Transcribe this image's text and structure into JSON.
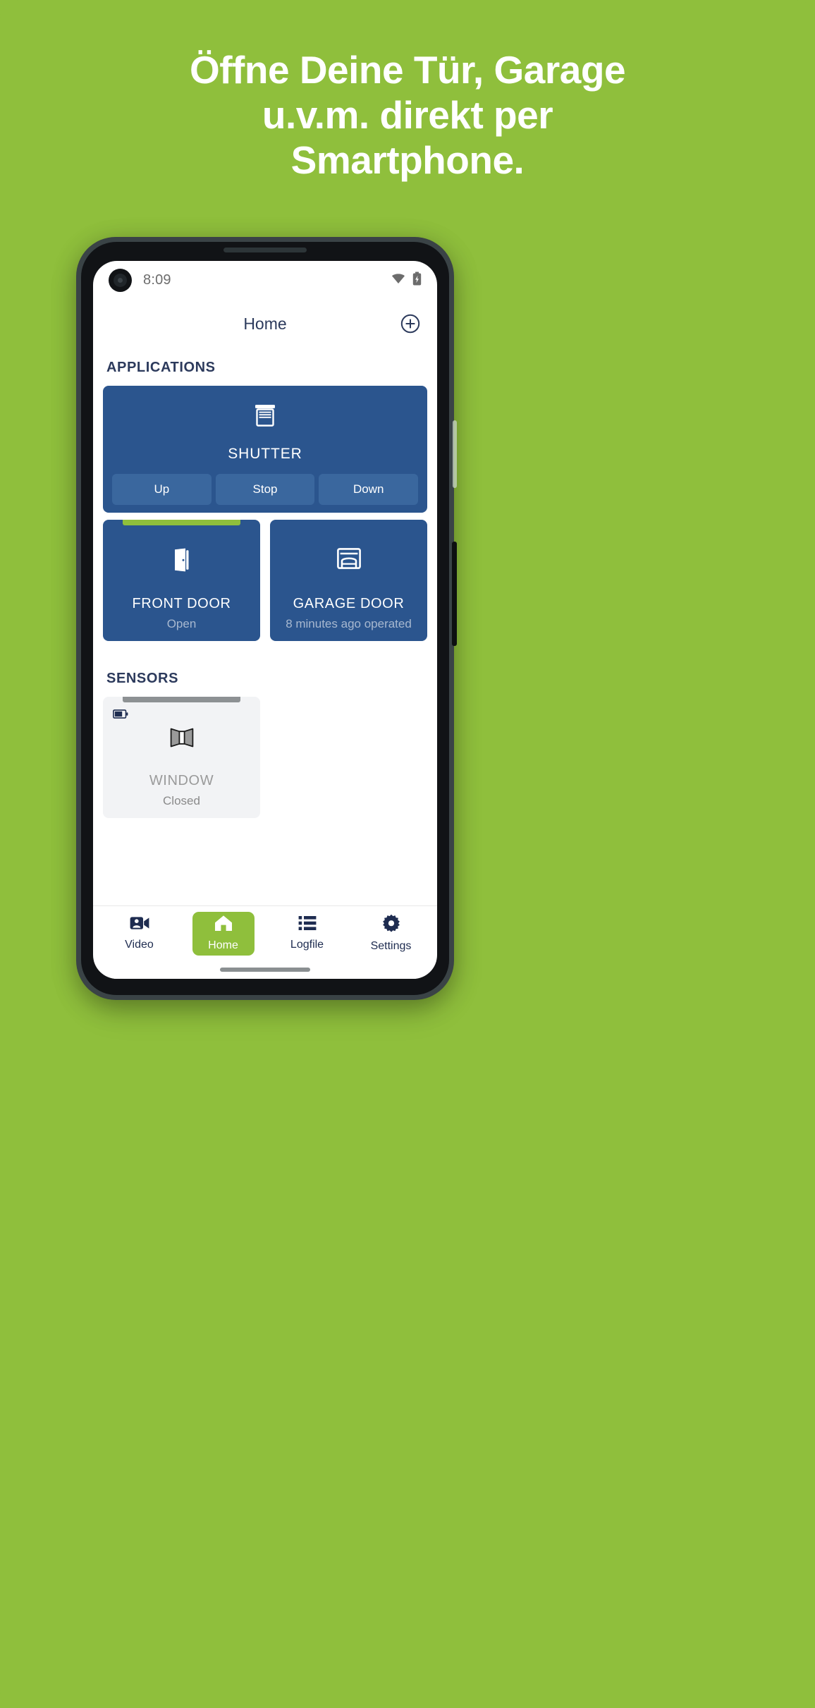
{
  "poster": {
    "background_color": "#8FBF3C",
    "headline_lines": [
      "Öffne Deine Tür, Garage",
      "u.v.m. direkt per",
      "Smartphone."
    ]
  },
  "phone": {
    "statusbar": {
      "time": "8:09",
      "wifi_icon": "wifi-icon",
      "battery_icon": "battery-charging-icon"
    },
    "appbar": {
      "title": "Home",
      "add_icon": "plus-circle-icon"
    },
    "sections": {
      "applications_title": "APPLICATIONS",
      "sensors_title": "SENSORS"
    },
    "shutter": {
      "icon": "shutter-icon",
      "label": "SHUTTER",
      "buttons": [
        {
          "label": "Up"
        },
        {
          "label": "Stop"
        },
        {
          "label": "Down"
        }
      ]
    },
    "tiles": [
      {
        "icon": "door-open-icon",
        "name": "FRONT DOOR",
        "status": "Open",
        "topbar": "green"
      },
      {
        "icon": "garage-door-icon",
        "name": "GARAGE DOOR",
        "status": "8 minutes ago operated",
        "topbar": "none"
      }
    ],
    "sensors": [
      {
        "battery_icon": "battery-icon",
        "icon": "window-icon",
        "name": "WINDOW",
        "status": "Closed",
        "topbar": "gray"
      }
    ],
    "bottomnav": [
      {
        "icon": "video-camera-icon",
        "label": "Video",
        "active": false
      },
      {
        "icon": "home-icon",
        "label": "Home",
        "active": true
      },
      {
        "icon": "list-icon",
        "label": "Logfile",
        "active": false
      },
      {
        "icon": "gear-icon",
        "label": "Settings",
        "active": false
      }
    ]
  },
  "colors": {
    "brand_green": "#8FBF3C",
    "card_blue": "#2B558E",
    "button_blue": "#3A679E",
    "navy_text": "#1E2C50"
  }
}
